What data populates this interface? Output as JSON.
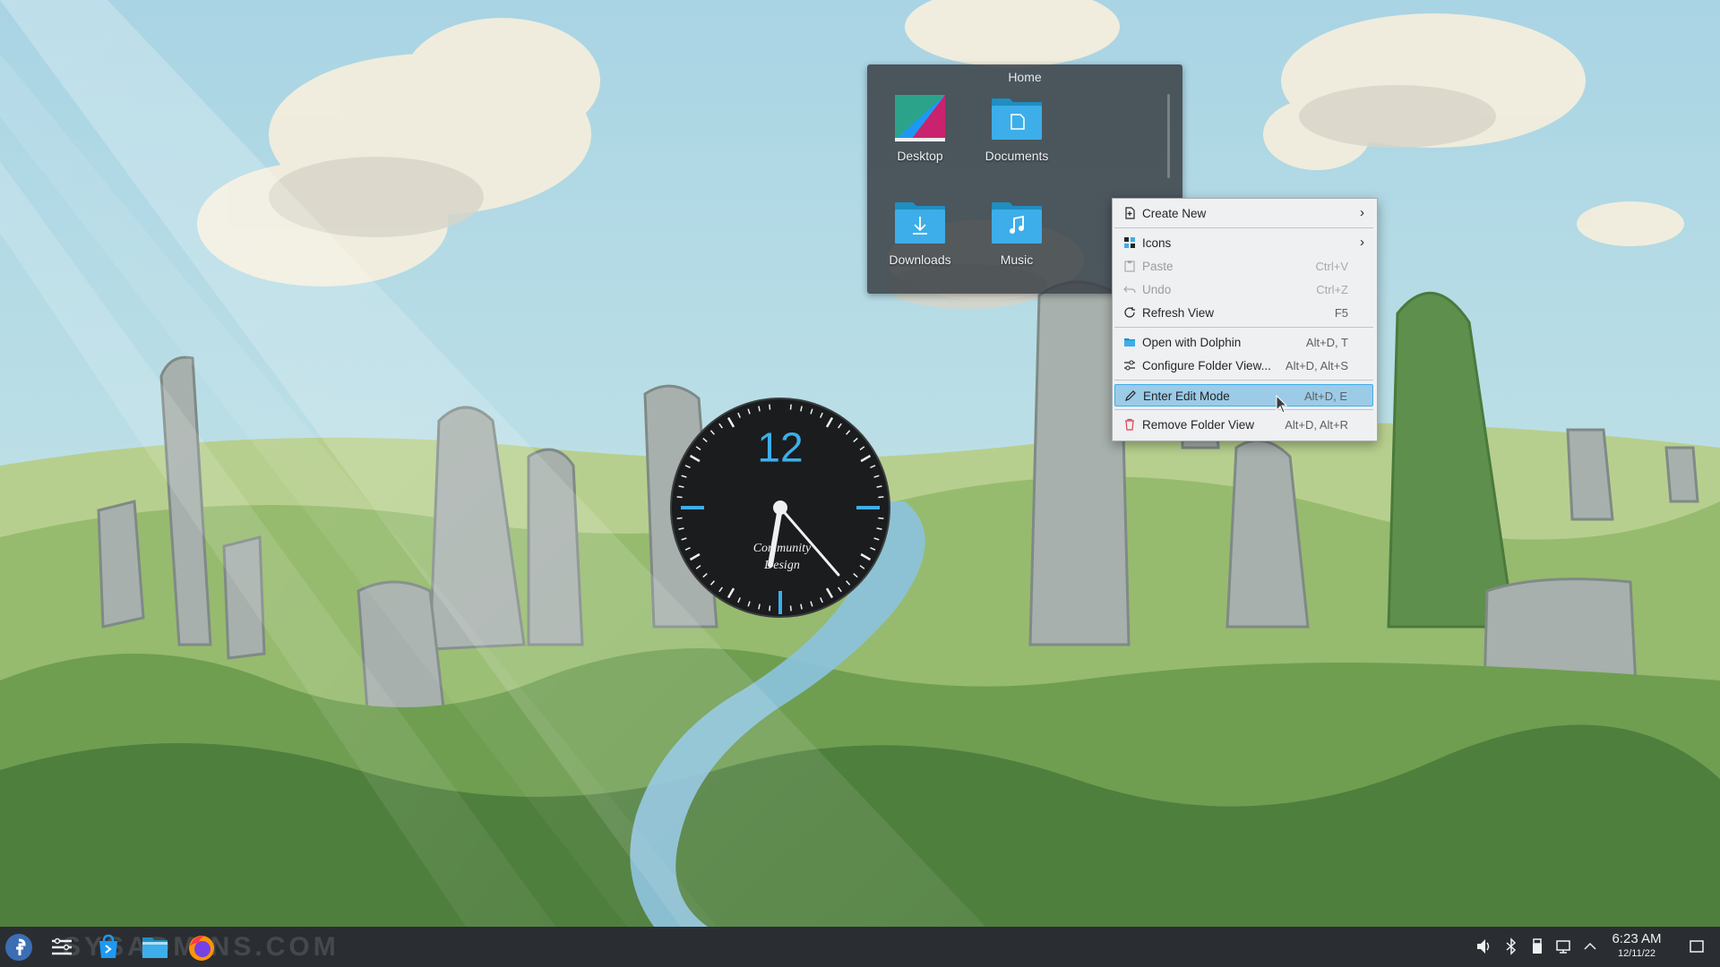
{
  "desktop": {
    "folder_view": {
      "title": "Home",
      "items": [
        {
          "label": "Desktop",
          "icon": "desktop-folder-icon"
        },
        {
          "label": "Documents",
          "icon": "documents-folder-icon"
        },
        {
          "label": "Downloads",
          "icon": "downloads-folder-icon"
        },
        {
          "label": "Music",
          "icon": "music-folder-icon"
        }
      ]
    },
    "clock_widget": {
      "numeral": "12",
      "brand_line1": "Community",
      "brand_line2": "Design",
      "time_shown": "6:23"
    }
  },
  "context_menu": {
    "items": [
      {
        "label": "Create New",
        "shortcut": "",
        "submenu": true,
        "icon": "new-document-icon",
        "enabled": true
      },
      {
        "label": "Icons",
        "shortcut": "",
        "submenu": true,
        "icon": "icons-grid-icon",
        "enabled": true
      },
      {
        "label": "Paste",
        "shortcut": "Ctrl+V",
        "icon": "paste-icon",
        "enabled": false
      },
      {
        "label": "Undo",
        "shortcut": "Ctrl+Z",
        "icon": "undo-icon",
        "enabled": false
      },
      {
        "label": "Refresh View",
        "shortcut": "F5",
        "icon": "refresh-icon",
        "enabled": true
      },
      {
        "label": "Open with Dolphin",
        "shortcut": "Alt+D, T",
        "icon": "dolphin-icon",
        "enabled": true
      },
      {
        "label": "Configure Folder View...",
        "shortcut": "Alt+D, Alt+S",
        "icon": "configure-icon",
        "enabled": true
      },
      {
        "label": "Enter Edit Mode",
        "shortcut": "Alt+D, E",
        "icon": "edit-icon",
        "enabled": true,
        "highlighted": true
      },
      {
        "label": "Remove Folder View",
        "shortcut": "Alt+D, Alt+R",
        "icon": "remove-icon",
        "enabled": true
      }
    ]
  },
  "taskbar": {
    "watermark": "SYSADMINS.COM",
    "launchers": [
      "fedora-launcher-icon",
      "task-manager-icon",
      "discover-icon",
      "dolphin-file-manager-icon",
      "firefox-icon"
    ],
    "tray": [
      "volume-icon",
      "bluetooth-icon",
      "usb-device-icon",
      "network-icon",
      "show-hidden-icons-icon"
    ],
    "clock": {
      "time": "6:23 AM",
      "date": "12/11/22"
    },
    "show_desktop": "show-desktop-icon"
  },
  "colors": {
    "accent": "#3daee9",
    "panel": "#2a2e32",
    "menu_bg": "#eff0f1",
    "highlight": "#9ccbe8"
  }
}
